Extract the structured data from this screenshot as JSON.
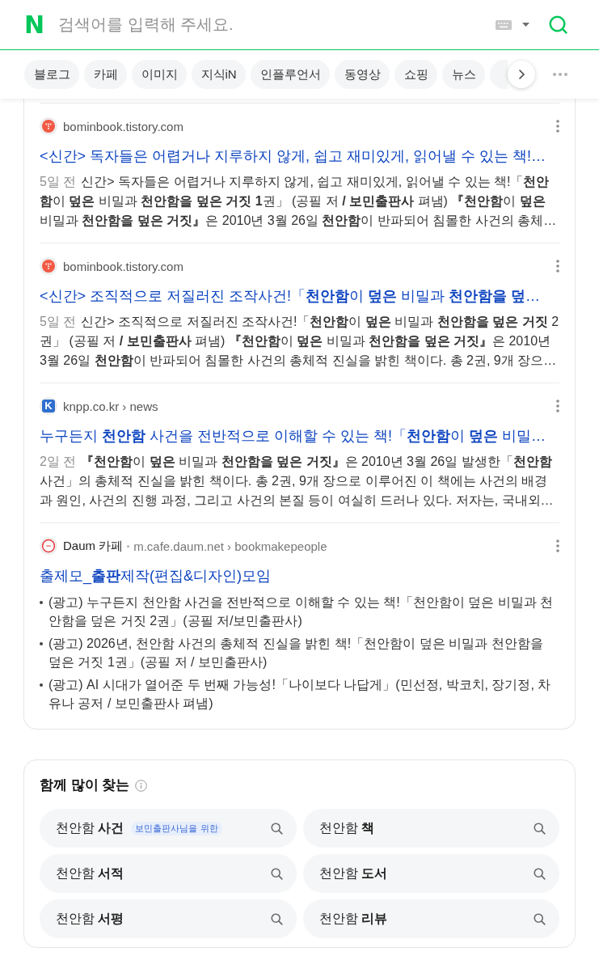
{
  "search_bar": {
    "logo": "N",
    "placeholder": "검색어를 입력해 주세요."
  },
  "tabs": [
    {
      "label": "블로그",
      "selected": false
    },
    {
      "label": "카페",
      "selected": false
    },
    {
      "label": "이미지",
      "selected": false
    },
    {
      "label": "지식iN",
      "selected": false
    },
    {
      "label": "인플루언서",
      "selected": false
    },
    {
      "label": "동영상",
      "selected": false
    },
    {
      "label": "쇼핑",
      "selected": false
    },
    {
      "label": "뉴스",
      "selected": false
    }
  ],
  "results": [
    {
      "kind": "snippet",
      "favicon": {
        "kind": "dots"
      },
      "url": "bominbook.tistory.com",
      "title": "<신간> 독자들은 어렵거나 지루하지 않게, 쉽고 재미있게, 읽어낼 수 있는 책!…",
      "date": "5일 전",
      "snippet": "신간> 독자들은 어렵거나 지루하지 않게, 쉽고 재미있게, 읽어낼 수 있는 책!「**천안함**이 **덮은** 비밀과 **천안함을 덮은 거짓 1**권」 (공필 저 **/ 보민출판사** 펴냄) **『천안함**이 **덮은** 비밀과 **천안함을 덮은 거짓』**은 2010년 3월 26일 **천안함**이 반파되어 침몰한 사건의 총체…"
    },
    {
      "kind": "snippet",
      "favicon": {
        "kind": "dots"
      },
      "url": "bominbook.tistory.com",
      "title": "<신간> 조직적으로 저질러진 조작사건!「**천안함**이 **덮은** 비밀과 **천안함을 덮**…",
      "date": "5일 전",
      "snippet": "신간> 조직적으로 저질러진 조작사건!「**천안함**이 **덮은** 비밀과 **천안함을 덮은 거짓** 2권」 (공필 저 **/ 보민출판사** 펴냄) **『천안함**이 **덮은** 비밀과 **천안함을 덮은 거짓』**은 2010년 3월 26일 **천안함**이 반파되어 침몰한 사건의 총체적 진실을 밝힌 책이다. 총 2권, 9개 장으…"
    },
    {
      "kind": "snippet",
      "favicon": {
        "kind": "letter",
        "letter": "K"
      },
      "url": "knpp.co.kr › news",
      "title": "누구든지 **천안함** 사건을 전반적으로 이해할 수 있는 책!「**천안함**이 **덮은** 비밀…",
      "date": "2일 전",
      "snippet": "**『천안함**이 **덮은** 비밀과 **천안함을 덮은 거짓』**은 2010년 3월 26일 발생한「**천안함** 사건」의 총체적 진실을 밝힌 책이다. 총 2권, 9개 장으로 이루어진 이 책에는 사건의 배경과 원인, 사건의 진행 과정, 그리고 사건의 본질 등이 여실히 드러나 있다. 저자는, 국내외…"
    },
    {
      "kind": "list",
      "favicon": {
        "kind": "ring"
      },
      "site_name": "Daum 카페",
      "url": "m.cafe.daum.net › bookmakepeople",
      "title": "출제모_**출판**제작(편집&디자인)모임",
      "items": [
        "(광고) 누구든지 천안함 사건을 전반적으로 이해할 수 있는 책!「천안함이 덮은 비밀과 천안함을 덮은 거짓 2권」(공필 저/보민출판사)",
        "(광고) 2026년, 천안함 사건의 총체적 진실을 밝힌 책!「천안함이 덮은 비밀과 천안함을 덮은 거짓 1권」(공필 저 / 보민출판사)",
        "(광고) AI 시대가 열어준 두 번째 가능성!「나이보다 나답게」(민선정, 박코치, 장기정, 차유나 공저 / 보민출판사 펴냄)"
      ]
    }
  ],
  "related": {
    "title": "함께 많이 찾는",
    "items": [
      {
        "text": "천안함 **사건**",
        "badge": "보민출판사님을 위한"
      },
      {
        "text": "천안함 **책**"
      },
      {
        "text": "천안함 **서적**"
      },
      {
        "text": "천안함 **도서**"
      },
      {
        "text": "천안함 **서평**"
      },
      {
        "text": "천안함 **리뷰**"
      }
    ]
  }
}
